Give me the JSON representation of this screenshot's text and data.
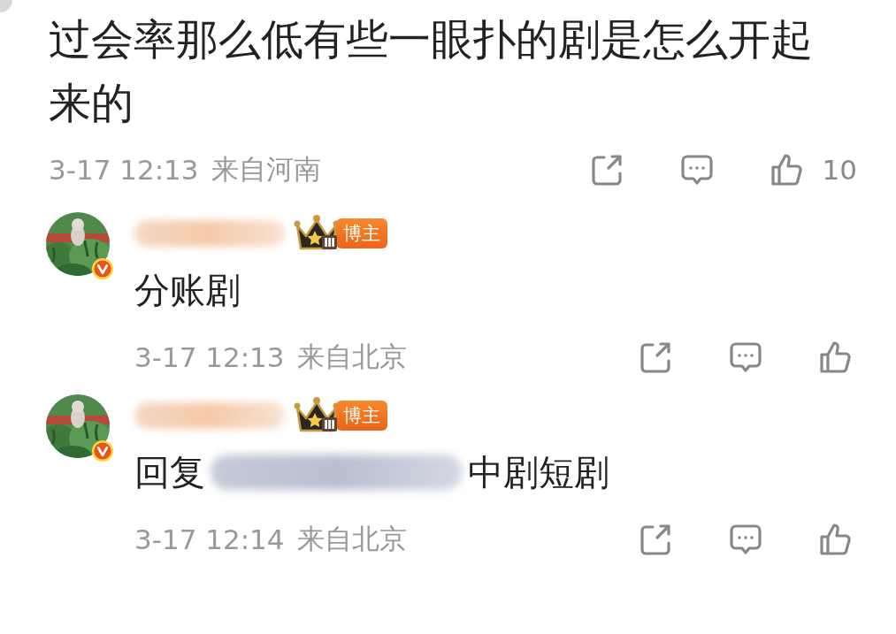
{
  "post": {
    "text": "过会率那么低有些一眼扑的剧是怎么开起来的",
    "time": "3-17 12:13",
    "location": "来自河南",
    "like_count": "10"
  },
  "replies": [
    {
      "badge": "博主",
      "badge_level": "Ⅲ",
      "verified": true,
      "text": "分账剧",
      "time": "3-17 12:13",
      "location": "来自北京"
    },
    {
      "badge": "博主",
      "badge_level": "Ⅲ",
      "verified": true,
      "reply_prefix": "回复",
      "text": "中剧短剧",
      "time": "3-17 12:14",
      "location": "来自北京"
    }
  ]
}
